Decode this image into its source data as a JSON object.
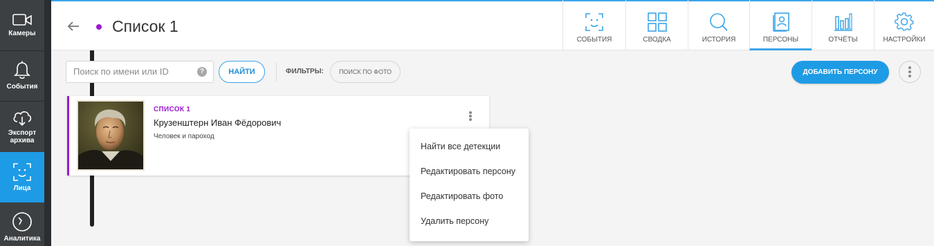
{
  "sidebar": {
    "items": [
      {
        "label": "Камеры",
        "icon": "camera-icon"
      },
      {
        "label": "События",
        "icon": "bell-icon"
      },
      {
        "label": "Экспорт архива",
        "icon": "cloud-download-icon"
      },
      {
        "label": "Лица",
        "icon": "face-frame-icon"
      },
      {
        "label": "Аналитика",
        "icon": "analytics-icon"
      }
    ],
    "active": "Лица"
  },
  "header": {
    "title": "Список 1",
    "tabs": [
      {
        "label": "СОБЫТИЯ",
        "icon": "face-frame-icon"
      },
      {
        "label": "СВОДКА",
        "icon": "grid-icon"
      },
      {
        "label": "ИСТОРИЯ",
        "icon": "search-icon"
      },
      {
        "label": "ПЕРСОНЫ",
        "icon": "person-book-icon"
      },
      {
        "label": "ОТЧЁТЫ",
        "icon": "bar-chart-icon"
      },
      {
        "label": "НАСТРОЙКИ",
        "icon": "gear-icon"
      }
    ],
    "active_tab": "ПЕРСОНЫ"
  },
  "toolbar": {
    "search_placeholder": "Поиск по имени или ID",
    "help": "?",
    "find_label": "НАЙТИ",
    "filters_label": "ФИЛЬТРЫ:",
    "photo_search_label": "ПОИСК ПО ФОТО",
    "add_person_label": "ДОБАВИТЬ ПЕРСОНУ"
  },
  "person_card": {
    "list_name": "СПИСОК 1",
    "name": "Крузенштерн Иван Фёдорович",
    "description": "Человек и пароход"
  },
  "context_menu": {
    "items": [
      "Найти все детекции",
      "Редактировать персону",
      "Редактировать фото",
      "Удалить персону"
    ]
  },
  "colors": {
    "accent": "#1e9be5",
    "list_purple": "#9b1ad1",
    "sidebar_bg": "#3c4043"
  }
}
